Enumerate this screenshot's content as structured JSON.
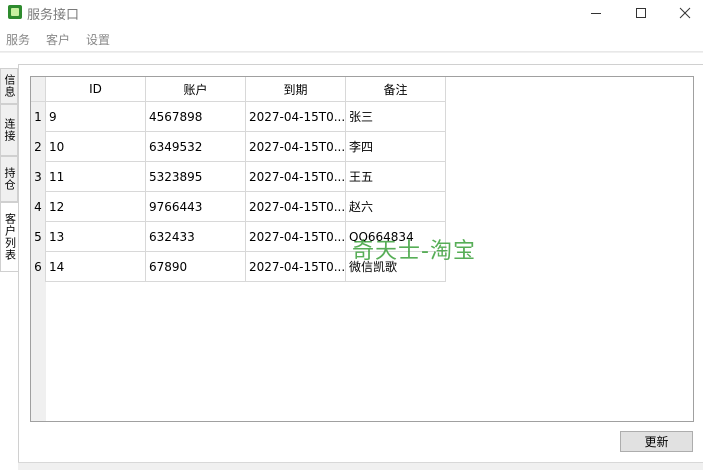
{
  "window": {
    "title": "服务接口",
    "icons": {
      "app": "app-icon",
      "minimize": "minimize-icon",
      "maximize": "maximize-icon",
      "close": "close-icon"
    }
  },
  "menu": {
    "items": [
      {
        "label": "服务"
      },
      {
        "label": "客户"
      },
      {
        "label": "设置"
      }
    ]
  },
  "tabs": [
    {
      "label": "信息"
    },
    {
      "label": "连接"
    },
    {
      "label": "持仓"
    },
    {
      "label": "客户列表",
      "active": true
    }
  ],
  "table": {
    "columns": [
      "ID",
      "账户",
      "到期",
      "备注"
    ],
    "rows": [
      {
        "num": "1",
        "id": "9",
        "account": "4567898",
        "expiry": "2027-04-15T0...",
        "note": "张三"
      },
      {
        "num": "2",
        "id": "10",
        "account": "6349532",
        "expiry": "2027-04-15T0...",
        "note": "李四"
      },
      {
        "num": "3",
        "id": "11",
        "account": "5323895",
        "expiry": "2027-04-15T0...",
        "note": "王五"
      },
      {
        "num": "4",
        "id": "12",
        "account": "9766443",
        "expiry": "2027-04-15T0...",
        "note": "赵六"
      },
      {
        "num": "5",
        "id": "13",
        "account": "632433",
        "expiry": "2027-04-15T0...",
        "note": "QQ664834"
      },
      {
        "num": "6",
        "id": "14",
        "account": "67890",
        "expiry": "2027-04-15T0...",
        "note": "微信凯歌"
      }
    ]
  },
  "watermark": "奇天士-淘宝",
  "actions": {
    "update_label": "更新"
  }
}
